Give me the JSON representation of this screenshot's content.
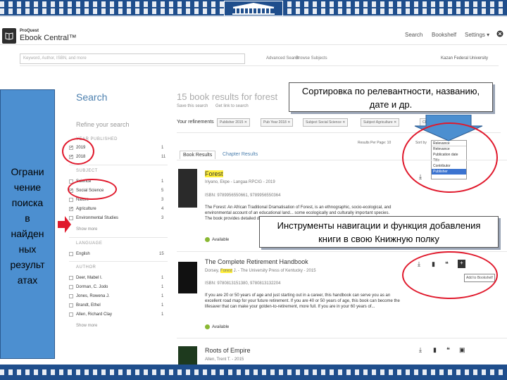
{
  "header": {
    "logo_brand": "ProQuest",
    "logo_product": "Ebook Central™",
    "nav": [
      "Search",
      "Bookshelf",
      "Settings ▾"
    ],
    "search_placeholder": "Keyword, Author, ISBN, and more",
    "advanced_search": "Advanced Search",
    "browse_subjects": "Browse Subjects",
    "institution": "Kazan Federal University"
  },
  "main": {
    "search_heading": "Search",
    "results_heading": "15 book results for forest",
    "save_search": "Save this search",
    "get_link": "Get link to search",
    "refine_heading": "Refine your search",
    "your_refinements": "Your refinements",
    "chips": [
      "Publisher 2015 ✕",
      "Pub Year 2018 ✕",
      "Subject Social Science ✕",
      "Subject Agriculture ✕",
      "Clear"
    ],
    "tabs": [
      "Book Results",
      "Chapter Results"
    ],
    "results_per_page": "Results Per Page: 10",
    "sort_label": "Sort by",
    "sort_selected": "Relevance",
    "sort_options": [
      "Relevance",
      "Publication date",
      "Title",
      "Contributor",
      "Publisher"
    ],
    "facets": {
      "year_heading": "YEAR PUBLISHED",
      "years": [
        {
          "label": "2019",
          "count": "1"
        },
        {
          "label": "2018",
          "count": "11"
        }
      ],
      "subject_heading": "SUBJECT",
      "subjects": [
        {
          "label": "Science",
          "count": "1"
        },
        {
          "label": "Social Science",
          "count": "5"
        },
        {
          "label": "Nature",
          "count": "3"
        },
        {
          "label": "Agriculture",
          "count": "4"
        },
        {
          "label": "Environmental Studies",
          "count": "3"
        }
      ],
      "show_more": "Show more",
      "language_heading": "LANGUAGE",
      "languages": [
        {
          "label": "English",
          "count": "15"
        }
      ],
      "author_heading": "AUTHOR",
      "authors": [
        {
          "label": "Deer, Mabel I.",
          "count": "1"
        },
        {
          "label": "Dorman, C. Jodo",
          "count": "1"
        },
        {
          "label": "Jones, Rowena J.",
          "count": "1"
        },
        {
          "label": "Brandt, Ethel",
          "count": "1"
        },
        {
          "label": "Allen, Richard Clay",
          "count": "1"
        }
      ]
    },
    "results": [
      {
        "title": "Forest",
        "authors": "Iriyano, Ekpe - Langaa RPCIG - 2019",
        "isbn": "ISBN: 9789956550661, 9789956550364",
        "description": "The Forest: An African Traditional Dramatisation of Forest, is an ethnographic, socio-ecological, and environmental account of an educational land... some ecologically and culturally important species. The book provides detailed description of Africa a...",
        "available": "Available"
      },
      {
        "title_pre": "The Complete Retirement Handbook",
        "authors_pre": "Dorsey,",
        "authors_hl": "Forest",
        "authors_post": "J. - The University Press of Kentucky - 2015",
        "isbn": "ISBN: 9780813151380, 9780813132204",
        "description": "If you are 20 or 50 years of age and just starting out in a career, this handbook can serve you as an excellent road map for your future retirement. If you are 40 or 50 years of age, this book can become the lifesaver that can make your golden-to-retirement, more full. If you are in your 60 years of...",
        "available": "Available",
        "add_bookshelf": "Add to Bookshelf"
      },
      {
        "title": "Roots of Empire",
        "authors": "Allen, Trent T. - 2015"
      }
    ]
  },
  "annotations": {
    "left_panel": "Ограни\nчение\nпоиска\nв\nнайден\nных\nрезульт\nатах",
    "sort_callout": "Сортировка по релевантности, названию, дате и др.",
    "tools_callout": "Инструменты навигации и функция добавления книги  в свою Книжную полку"
  },
  "colors": {
    "accent": "#4b7fae",
    "annotation_red": "#e0192c",
    "panel_blue": "#4c8fd0",
    "highlight": "#ffef3a",
    "available_green": "#8ab833"
  }
}
